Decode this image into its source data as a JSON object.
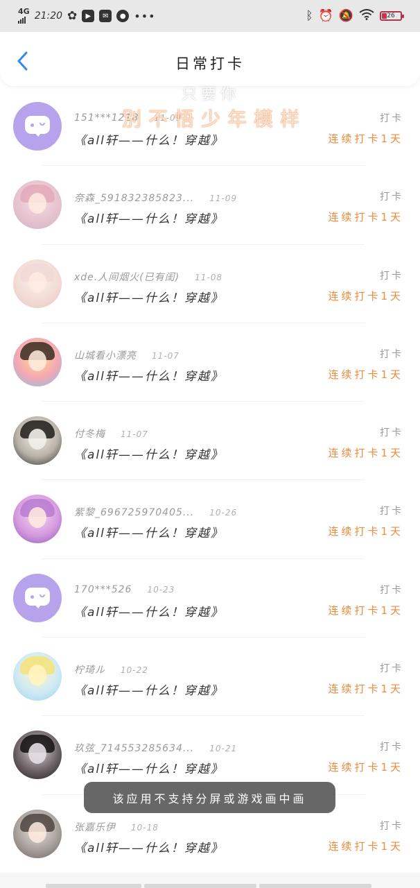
{
  "status_bar": {
    "network": "4G",
    "time": "21:20",
    "battery": "26"
  },
  "header": {
    "title": "日常打卡"
  },
  "watermark": {
    "line1": "只要你",
    "line2": "別不悟少年模样"
  },
  "entries": [
    {
      "user": "151***1218",
      "date": "11-09",
      "content": "《all轩——什么！穿越》",
      "action": "打卡",
      "streak": "连续打卡1天",
      "avatar": "default"
    },
    {
      "user": "奈森_591832385823...",
      "date": "11-09",
      "content": "《all轩——什么！穿越》",
      "action": "打卡",
      "streak": "连续打卡1天",
      "avatar": "photo"
    },
    {
      "user": "xde.人间烟火(已有闺)",
      "date": "11-08",
      "content": "《all轩——什么！穿越》",
      "action": "打卡",
      "streak": "连续打卡1天",
      "avatar": "photo"
    },
    {
      "user": "山城看小漂亮",
      "date": "11-07",
      "content": "《all轩——什么！穿越》",
      "action": "打卡",
      "streak": "连续打卡1天",
      "avatar": "photo"
    },
    {
      "user": "付冬梅",
      "date": "11-07",
      "content": "《all轩——什么！穿越》",
      "action": "打卡",
      "streak": "连续打卡1天",
      "avatar": "photo"
    },
    {
      "user": "紫黎_696725970405...",
      "date": "10-26",
      "content": "《all轩——什么！穿越》",
      "action": "打卡",
      "streak": "连续打卡1天",
      "avatar": "photo"
    },
    {
      "user": "170***526",
      "date": "10-23",
      "content": "《all轩——什么！穿越》",
      "action": "打卡",
      "streak": "连续打卡1天",
      "avatar": "default"
    },
    {
      "user": "柠琦ル",
      "date": "10-22",
      "content": "《all轩——什么！穿越》",
      "action": "打卡",
      "streak": "连续打卡1天",
      "avatar": "photo"
    },
    {
      "user": "玖弦_714553285634...",
      "date": "10-21",
      "content": "《all轩——什么！穿越》",
      "action": "打卡",
      "streak": "连续打卡1天",
      "avatar": "photo"
    },
    {
      "user": "张嘉乐伊",
      "date": "10-18",
      "content": "《all轩——什么！穿越》",
      "action": "打卡",
      "streak": "连续打卡1天",
      "avatar": "photo"
    }
  ],
  "toast": "该应用不支持分屏或游戏画中画",
  "colors": {
    "accent_orange": "#f08a3c",
    "back_arrow": "#2f8cf0",
    "default_avatar": "#b7a2ec"
  }
}
